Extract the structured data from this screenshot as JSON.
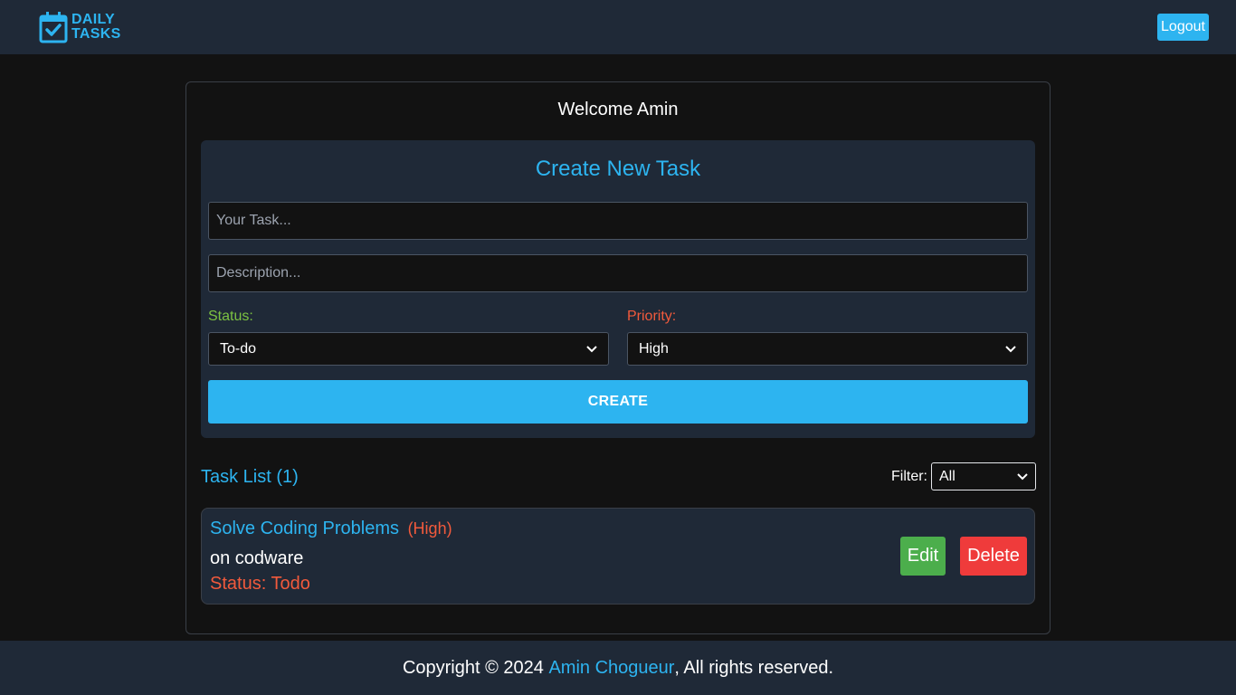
{
  "header": {
    "logo_line1": "DAILY",
    "logo_line2": "TASKS",
    "logout_label": "Logout"
  },
  "welcome_text": "Welcome Amin",
  "create_form": {
    "title": "Create New Task",
    "task_placeholder": "Your Task...",
    "task_value": "",
    "description_placeholder": "Description...",
    "description_value": "",
    "status_label": "Status:",
    "status_selected": "To-do",
    "priority_label": "Priority:",
    "priority_selected": "High",
    "create_label": "CREATE"
  },
  "task_list": {
    "title": "Task List (1)",
    "filter_label": "Filter:",
    "filter_selected": "All",
    "tasks": [
      {
        "title": "Solve Coding Problems",
        "priority": "(High)",
        "description": "on codware",
        "status": "Status: Todo",
        "edit_label": "Edit",
        "delete_label": "Delete"
      }
    ]
  },
  "footer": {
    "prefix": "Copyright © 2024 ",
    "author": "Amin Chogueur",
    "suffix": ", All rights reserved."
  },
  "colors": {
    "accent": "#2db4f0",
    "status_label": "#7cc242",
    "priority": "#f25a3c",
    "edit": "#4cae4c",
    "delete": "#ef3b3b",
    "panel": "#1f2937",
    "background": "#121212"
  },
  "icons": {
    "logo": "calendar-check-icon",
    "select_arrow": "chevron-down-icon"
  }
}
